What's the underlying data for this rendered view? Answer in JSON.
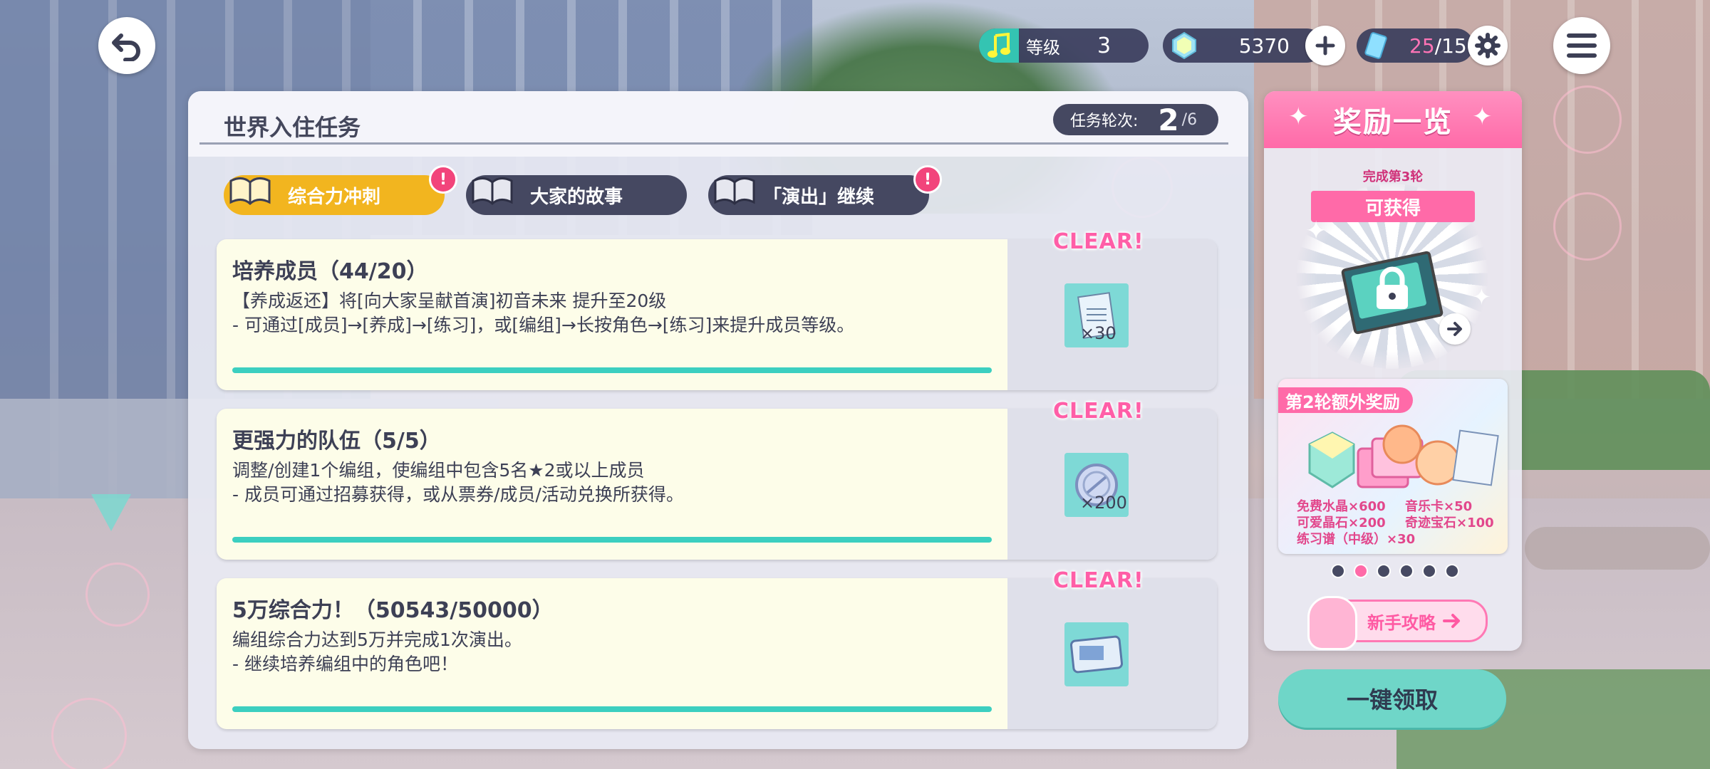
{
  "colors": {
    "accent_teal": "#3ccfc0",
    "accent_pink": "#ff6aa8",
    "tab_active": "#f2b51f",
    "dark_pill": "#454861"
  },
  "topbar": {
    "level_label": "等级",
    "level_value": "3",
    "crystals": "5370",
    "stamina_current": "25",
    "stamina_sep": "/",
    "stamina_max": "15",
    "icons": [
      "back-icon",
      "music-note-icon",
      "crystal-icon",
      "plus-icon",
      "ticket-icon",
      "gear-icon",
      "menu-icon"
    ]
  },
  "panel": {
    "title": "世界入住任务",
    "round_label": "任务轮次:",
    "round_current": "2",
    "round_total": "/6"
  },
  "tabs": [
    {
      "label": "综合力冲刺",
      "badge": "!"
    },
    {
      "label": "大家的故事"
    },
    {
      "label": "「演出」继续",
      "badge": "!"
    }
  ],
  "missions": [
    {
      "title": "培养成员（44/20）",
      "line1": "【养成返还】将[向大家呈献首演]初音未来 提升至20级",
      "line2": "- 可通过[成员]→[养成]→[练习]，或[编组]→长按角色→[练习]来提升成员等级。",
      "status": "CLEAR!",
      "reward_icon": "score-sheet-icon",
      "reward_qty": "×30",
      "progress": 1.0
    },
    {
      "title": "更强力的队伍（5/5）",
      "line1": "调整/创建1个编组，使编组中包含5名★2或以上成员",
      "line2": "- 成员可通过招募获得，或从票券/成员/活动兑换所获得。",
      "status": "CLEAR!",
      "reward_icon": "coin-icon",
      "reward_qty": "×200",
      "progress": 1.0
    },
    {
      "title": "5万综合力！（50543/50000）",
      "line1": "编组综合力达到5万并完成1次演出。",
      "line2": "- 继续培养编组中的角色吧！",
      "status": "CLEAR!",
      "reward_icon": "gacha-ticket-icon",
      "reward_qty": "",
      "progress": 1.0
    }
  ],
  "rewards": {
    "title": "奖励一览",
    "ribbon_top": "完成第3轮",
    "ribbon_main": "可获得",
    "extra_tag": "第2轮额外奖励",
    "extra_items": [
      "免费水晶×600",
      "音乐卡×50",
      "可爱晶石×200",
      "奇迹宝石×100",
      "练习谱（中级）×30"
    ],
    "page_dots": 6,
    "active_dot": 1,
    "guide_label": "新手攻略",
    "claim_label": "一键领取"
  }
}
